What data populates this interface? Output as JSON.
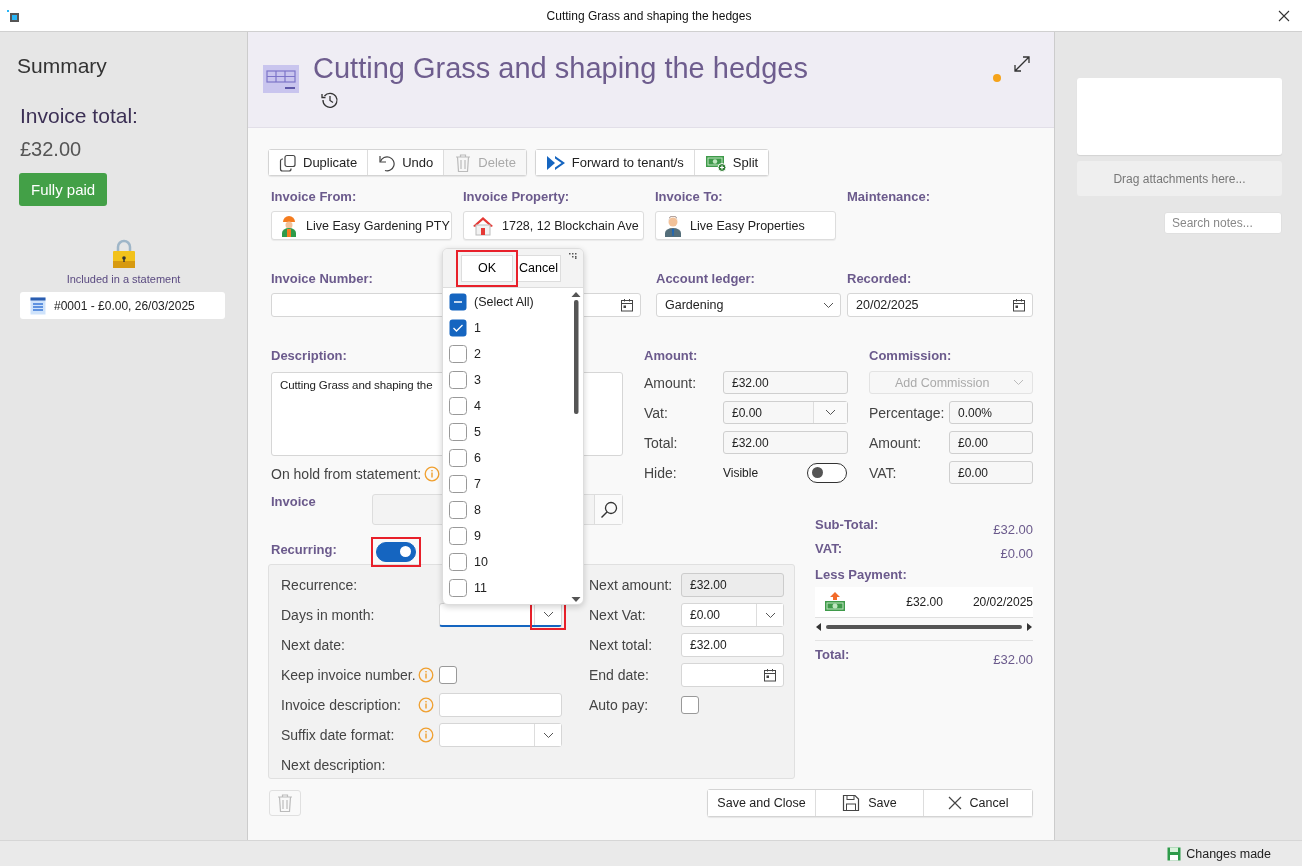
{
  "window": {
    "title": "Cutting Grass and shaping the hedges"
  },
  "summary": {
    "heading": "Summary",
    "total_label": "Invoice total:",
    "total": "£32.00",
    "status": "Fully paid",
    "locked": true,
    "lock_caption": "Included in a statement",
    "statement": "#0001 - £0.00, 26/03/2025"
  },
  "header": {
    "title": "Cutting Grass and shaping the hedges",
    "unsaved": true
  },
  "toolbar": [
    [
      {
        "label": "Duplicate",
        "disabled": false
      },
      {
        "label": "Undo",
        "disabled": false
      },
      {
        "label": "Delete",
        "disabled": true
      }
    ],
    [
      {
        "label": "Forward to tenant/s",
        "disabled": false
      },
      {
        "label": "Split",
        "disabled": false
      }
    ]
  ],
  "parties": [
    {
      "label": "Invoice From:",
      "value": "Live Easy Gardening PTY",
      "kind": "worker"
    },
    {
      "label": "Invoice Property:",
      "value": "1728, 12 Blockchain Ave",
      "kind": "house"
    },
    {
      "label": "Invoice To:",
      "value": "Live Easy Properties",
      "kind": "person"
    },
    {
      "label": "Maintenance:",
      "kind": "none"
    }
  ],
  "invoice_number": {
    "label": "Invoice Number:"
  },
  "account_ledger": {
    "label": "Account ledger:",
    "value": "Gardening"
  },
  "recorded": {
    "label": "Recorded:",
    "value": "20/02/2025"
  },
  "description": {
    "label": "Description:",
    "value": "Cutting Grass and shaping the"
  },
  "on_hold": {
    "label": "On hold from statement:"
  },
  "invoice_search": {
    "label": "Invoice"
  },
  "recurring": {
    "label": "Recurring:",
    "on": true,
    "highlighted": true
  },
  "amount": {
    "heading": "Amount:",
    "rows": [
      {
        "label": "Amount:",
        "value": "£32.00",
        "kind": "field"
      },
      {
        "label": "Vat:",
        "value": "£0.00",
        "kind": "combo"
      },
      {
        "label": "Total:",
        "value": "£32.00",
        "kind": "field"
      },
      {
        "label": "Hide:",
        "value": "Visible",
        "kind": "toggle",
        "on": false
      }
    ]
  },
  "commission": {
    "heading": "Commission:",
    "placeholder": "Add Commission",
    "disabled": true,
    "rows": [
      {
        "label": "Percentage:",
        "value": "0.00%"
      },
      {
        "label": "Amount:",
        "value": "£0.00"
      },
      {
        "label": "VAT:",
        "value": "£0.00"
      }
    ]
  },
  "totals": [
    {
      "label": "Sub-Total:",
      "value": "£32.00"
    },
    {
      "label": "VAT:",
      "value": "£0.00"
    }
  ],
  "less_payment": {
    "label": "Less Payment:",
    "payments": [
      {
        "amount": "£32.00",
        "date": "20/02/2025"
      }
    ]
  },
  "total": {
    "label": "Total:",
    "value": "£32.00"
  },
  "recurrence": {
    "left": [
      {
        "label": "Recurrence:",
        "kind": "none"
      },
      {
        "label": "Days in month:",
        "kind": "combo",
        "focused": true,
        "highlighted": true
      },
      {
        "label": "Next date:",
        "kind": "none"
      },
      {
        "label": "Keep invoice number.",
        "kind": "checkbox",
        "info": true,
        "checked": false
      },
      {
        "label": "Invoice description:",
        "kind": "text",
        "info": true
      },
      {
        "label": "Suffix date format:",
        "kind": "combo",
        "info": true
      },
      {
        "label": "Next description:",
        "kind": "none"
      }
    ],
    "right": [
      {
        "label": "Next amount:",
        "value": "£32.00",
        "kind": "readonly"
      },
      {
        "label": "Next Vat:",
        "value": "£0.00",
        "kind": "combo"
      },
      {
        "label": "Next total:",
        "value": "£32.00",
        "kind": "text"
      },
      {
        "label": "End date:",
        "kind": "date"
      },
      {
        "label": "Auto pay:",
        "kind": "checkbox",
        "checked": false
      }
    ]
  },
  "actions": [
    {
      "label": "Save and Close",
      "kind": "plain"
    },
    {
      "label": "Save",
      "kind": "save"
    },
    {
      "label": "Cancel",
      "kind": "cancel"
    }
  ],
  "filter_popup": {
    "ok": "OK",
    "cancel": "Cancel",
    "ok_highlighted": true,
    "select_all": {
      "label": "(Select All)",
      "indeterminate": true
    },
    "items": [
      {
        "label": "1",
        "checked": true
      },
      {
        "label": "2",
        "checked": false
      },
      {
        "label": "3",
        "checked": false
      },
      {
        "label": "4",
        "checked": false
      },
      {
        "label": "5",
        "checked": false
      },
      {
        "label": "6",
        "checked": false
      },
      {
        "label": "7",
        "checked": false
      },
      {
        "label": "8",
        "checked": false
      },
      {
        "label": "9",
        "checked": false
      },
      {
        "label": "10",
        "checked": false
      },
      {
        "label": "11",
        "checked": false
      }
    ]
  },
  "attachments": {
    "drop_hint": "Drag attachments here...",
    "search_placeholder": "Search notes..."
  },
  "status_bar": {
    "text": "Changes made"
  }
}
